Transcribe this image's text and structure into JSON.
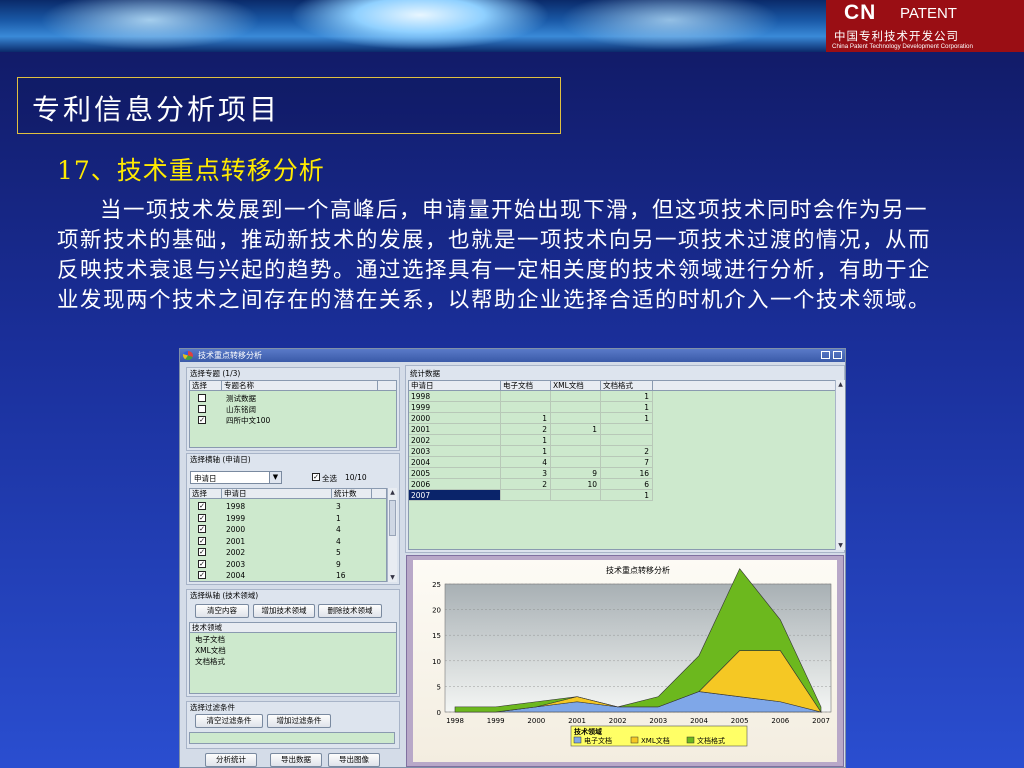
{
  "header": {
    "logo_brand": "CN",
    "logo_brand2": "PATENT",
    "logo_zh": "中国专利技术开发公司",
    "logo_en": "China Patent Technology Development Corporation"
  },
  "slide": {
    "title": "专利信息分析项目",
    "subtitle": "17、技术重点转移分析",
    "paragraph": "当一项技术发展到一个高峰后，申请量开始出现下滑，但这项技术同时会作为另一项新技术的基础，推动新技术的发展，也就是一项技术向另一项技术过渡的情况，从而反映技术衰退与兴起的趋势。通过选择具有一定相关度的技术领域进行分析，有助于企业发现两个技术之间存在的潜在关系，以帮助企业选择合适的时机介入一个技术领域。"
  },
  "app": {
    "window_title": "技术重点转移分析",
    "topic_group": {
      "label": "选择专题 (1/3)",
      "col_select": "选择",
      "col_name": "专题名称",
      "rows": [
        {
          "checked": false,
          "name": "测试数据"
        },
        {
          "checked": false,
          "name": "山东铭阔"
        },
        {
          "checked": true,
          "name": "四所中文100"
        }
      ]
    },
    "xaxis_group": {
      "label": "选择横轴 (申请日)",
      "select_value": "申请日",
      "select_all_label": "全选",
      "select_count": "10/10",
      "col_select": "选择",
      "col_date": "申请日",
      "col_count": "统计数",
      "rows": [
        {
          "year": "1998",
          "count": "3"
        },
        {
          "year": "1999",
          "count": "1"
        },
        {
          "year": "2000",
          "count": "4"
        },
        {
          "year": "2001",
          "count": "4"
        },
        {
          "year": "2002",
          "count": "5"
        },
        {
          "year": "2003",
          "count": "9"
        },
        {
          "year": "2004",
          "count": "16"
        }
      ]
    },
    "yaxis_group": {
      "label": "选择纵轴 (技术领域)",
      "btn_clear": "清空内容",
      "btn_add": "增加技术领域",
      "btn_delete": "删除技术领域",
      "col_field": "技术领域",
      "fields": [
        "电子文档",
        "XML文档",
        "文档格式"
      ]
    },
    "filter_group": {
      "label": "选择过滤条件",
      "btn_clear": "清空过滤条件",
      "btn_add": "增加过滤条件"
    },
    "bottom_buttons": {
      "analyze": "分析统计",
      "export_data": "导出数据",
      "export_image": "导出图像"
    },
    "stats_group": {
      "label": "统计数据",
      "columns": [
        "申请日",
        "电子文档",
        "XML文档",
        "文档格式"
      ],
      "rows": [
        [
          "1998",
          "",
          "",
          "1"
        ],
        [
          "1999",
          "",
          "",
          "1"
        ],
        [
          "2000",
          "1",
          "",
          "1"
        ],
        [
          "2001",
          "2",
          "1",
          ""
        ],
        [
          "2002",
          "1",
          "",
          ""
        ],
        [
          "2003",
          "1",
          "",
          "2"
        ],
        [
          "2004",
          "4",
          "",
          "7"
        ],
        [
          "2005",
          "3",
          "9",
          "16"
        ],
        [
          "2006",
          "2",
          "10",
          "6"
        ],
        [
          "2007",
          "",
          "",
          "1"
        ]
      ]
    },
    "colors": {
      "green_area": "#6cb81e",
      "yellow_area": "#f5c824",
      "blue_area": "#7fa7e8",
      "grid_bg": "#cde9cd",
      "selection": "#0a246a"
    }
  },
  "chart_data": {
    "type": "area",
    "title": "技术重点转移分析",
    "categories": [
      "1998",
      "1999",
      "2000",
      "2001",
      "2002",
      "2003",
      "2004",
      "2005",
      "2006",
      "2007"
    ],
    "series": [
      {
        "name": "电子文档",
        "values": [
          0,
          0,
          1,
          2,
          1,
          1,
          4,
          3,
          2,
          0
        ]
      },
      {
        "name": "XML文档",
        "values": [
          0,
          0,
          0,
          1,
          0,
          0,
          0,
          9,
          10,
          0
        ]
      },
      {
        "name": "文档格式",
        "values": [
          1,
          1,
          1,
          0,
          0,
          2,
          7,
          16,
          6,
          1
        ]
      }
    ],
    "stacked": true,
    "ylim": [
      0,
      25
    ],
    "yticks": [
      "0",
      "5",
      "10",
      "15",
      "20",
      "25"
    ],
    "legend_title": "技术领域",
    "legend_position": "bottom",
    "grid": true
  }
}
